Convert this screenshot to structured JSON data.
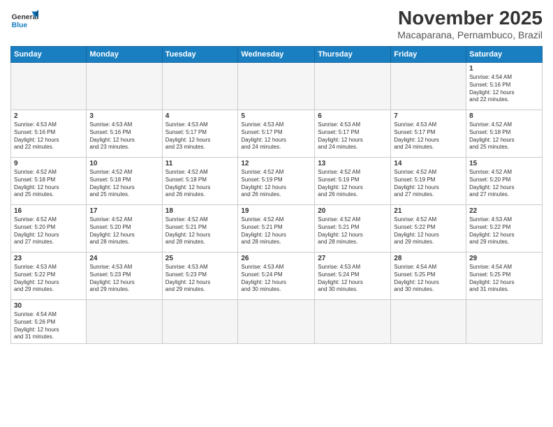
{
  "header": {
    "logo_general": "General",
    "logo_blue": "Blue",
    "month_title": "November 2025",
    "location": "Macaparana, Pernambuco, Brazil"
  },
  "days_of_week": [
    "Sunday",
    "Monday",
    "Tuesday",
    "Wednesday",
    "Thursday",
    "Friday",
    "Saturday"
  ],
  "weeks": [
    [
      {
        "day": "",
        "info": ""
      },
      {
        "day": "",
        "info": ""
      },
      {
        "day": "",
        "info": ""
      },
      {
        "day": "",
        "info": ""
      },
      {
        "day": "",
        "info": ""
      },
      {
        "day": "",
        "info": ""
      },
      {
        "day": "1",
        "info": "Sunrise: 4:54 AM\nSunset: 5:16 PM\nDaylight: 12 hours\nand 22 minutes."
      }
    ],
    [
      {
        "day": "2",
        "info": "Sunrise: 4:53 AM\nSunset: 5:16 PM\nDaylight: 12 hours\nand 22 minutes."
      },
      {
        "day": "3",
        "info": "Sunrise: 4:53 AM\nSunset: 5:16 PM\nDaylight: 12 hours\nand 23 minutes."
      },
      {
        "day": "4",
        "info": "Sunrise: 4:53 AM\nSunset: 5:17 PM\nDaylight: 12 hours\nand 23 minutes."
      },
      {
        "day": "5",
        "info": "Sunrise: 4:53 AM\nSunset: 5:17 PM\nDaylight: 12 hours\nand 24 minutes."
      },
      {
        "day": "6",
        "info": "Sunrise: 4:53 AM\nSunset: 5:17 PM\nDaylight: 12 hours\nand 24 minutes."
      },
      {
        "day": "7",
        "info": "Sunrise: 4:53 AM\nSunset: 5:17 PM\nDaylight: 12 hours\nand 24 minutes."
      },
      {
        "day": "8",
        "info": "Sunrise: 4:52 AM\nSunset: 5:18 PM\nDaylight: 12 hours\nand 25 minutes."
      }
    ],
    [
      {
        "day": "9",
        "info": "Sunrise: 4:52 AM\nSunset: 5:18 PM\nDaylight: 12 hours\nand 25 minutes."
      },
      {
        "day": "10",
        "info": "Sunrise: 4:52 AM\nSunset: 5:18 PM\nDaylight: 12 hours\nand 25 minutes."
      },
      {
        "day": "11",
        "info": "Sunrise: 4:52 AM\nSunset: 5:18 PM\nDaylight: 12 hours\nand 26 minutes."
      },
      {
        "day": "12",
        "info": "Sunrise: 4:52 AM\nSunset: 5:19 PM\nDaylight: 12 hours\nand 26 minutes."
      },
      {
        "day": "13",
        "info": "Sunrise: 4:52 AM\nSunset: 5:19 PM\nDaylight: 12 hours\nand 26 minutes."
      },
      {
        "day": "14",
        "info": "Sunrise: 4:52 AM\nSunset: 5:19 PM\nDaylight: 12 hours\nand 27 minutes."
      },
      {
        "day": "15",
        "info": "Sunrise: 4:52 AM\nSunset: 5:20 PM\nDaylight: 12 hours\nand 27 minutes."
      }
    ],
    [
      {
        "day": "16",
        "info": "Sunrise: 4:52 AM\nSunset: 5:20 PM\nDaylight: 12 hours\nand 27 minutes."
      },
      {
        "day": "17",
        "info": "Sunrise: 4:52 AM\nSunset: 5:20 PM\nDaylight: 12 hours\nand 28 minutes."
      },
      {
        "day": "18",
        "info": "Sunrise: 4:52 AM\nSunset: 5:21 PM\nDaylight: 12 hours\nand 28 minutes."
      },
      {
        "day": "19",
        "info": "Sunrise: 4:52 AM\nSunset: 5:21 PM\nDaylight: 12 hours\nand 28 minutes."
      },
      {
        "day": "20",
        "info": "Sunrise: 4:52 AM\nSunset: 5:21 PM\nDaylight: 12 hours\nand 28 minutes."
      },
      {
        "day": "21",
        "info": "Sunrise: 4:52 AM\nSunset: 5:22 PM\nDaylight: 12 hours\nand 29 minutes."
      },
      {
        "day": "22",
        "info": "Sunrise: 4:53 AM\nSunset: 5:22 PM\nDaylight: 12 hours\nand 29 minutes."
      }
    ],
    [
      {
        "day": "23",
        "info": "Sunrise: 4:53 AM\nSunset: 5:22 PM\nDaylight: 12 hours\nand 29 minutes."
      },
      {
        "day": "24",
        "info": "Sunrise: 4:53 AM\nSunset: 5:23 PM\nDaylight: 12 hours\nand 29 minutes."
      },
      {
        "day": "25",
        "info": "Sunrise: 4:53 AM\nSunset: 5:23 PM\nDaylight: 12 hours\nand 29 minutes."
      },
      {
        "day": "26",
        "info": "Sunrise: 4:53 AM\nSunset: 5:24 PM\nDaylight: 12 hours\nand 30 minutes."
      },
      {
        "day": "27",
        "info": "Sunrise: 4:53 AM\nSunset: 5:24 PM\nDaylight: 12 hours\nand 30 minutes."
      },
      {
        "day": "28",
        "info": "Sunrise: 4:54 AM\nSunset: 5:25 PM\nDaylight: 12 hours\nand 30 minutes."
      },
      {
        "day": "29",
        "info": "Sunrise: 4:54 AM\nSunset: 5:25 PM\nDaylight: 12 hours\nand 31 minutes."
      }
    ],
    [
      {
        "day": "30",
        "info": "Sunrise: 4:54 AM\nSunset: 5:26 PM\nDaylight: 12 hours\nand 31 minutes."
      },
      {
        "day": "",
        "info": ""
      },
      {
        "day": "",
        "info": ""
      },
      {
        "day": "",
        "info": ""
      },
      {
        "day": "",
        "info": ""
      },
      {
        "day": "",
        "info": ""
      },
      {
        "day": "",
        "info": ""
      }
    ]
  ]
}
